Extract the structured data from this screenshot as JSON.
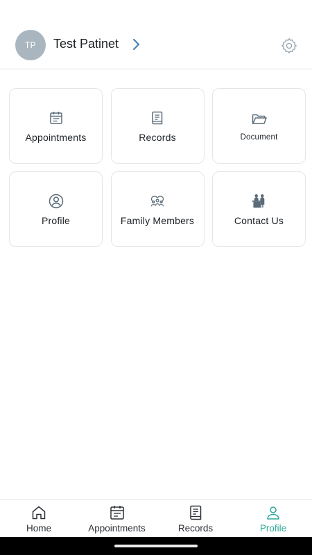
{
  "header": {
    "avatar_initials": "TP",
    "user_name": "Test Patinet",
    "accent_color": "#3d7fb3"
  },
  "tiles": [
    {
      "label": "Appointments",
      "icon": "calendar-icon"
    },
    {
      "label": "Records",
      "icon": "record-book-icon"
    },
    {
      "label": "Document",
      "icon": "folder-icon"
    },
    {
      "label": "Profile",
      "icon": "user-circle-icon"
    },
    {
      "label": "Family Members",
      "icon": "family-group-icon"
    },
    {
      "label": "Contact Us",
      "icon": "contact-desk-icon"
    }
  ],
  "bottom_nav": {
    "items": [
      {
        "label": "Home",
        "icon": "home-icon"
      },
      {
        "label": "Appointments",
        "icon": "calendar-icon"
      },
      {
        "label": "Records",
        "icon": "record-book-icon"
      },
      {
        "label": "Profile",
        "icon": "user-icon",
        "active": true
      }
    ],
    "active_color": "#2fa89a"
  }
}
